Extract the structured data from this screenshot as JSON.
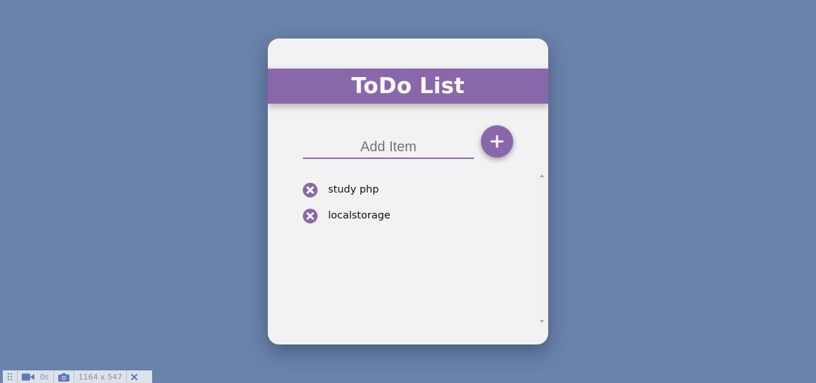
{
  "app": {
    "title": "ToDo List"
  },
  "input": {
    "placeholder": "Add Item",
    "value": ""
  },
  "add_button": {
    "icon": "plus-icon"
  },
  "items": [
    {
      "label": "study php",
      "icon": "remove-circle-icon"
    },
    {
      "label": "localstorage",
      "icon": "remove-circle-icon"
    }
  ],
  "toolbar": {
    "timer": "0s",
    "dimensions": "1164 x 547"
  },
  "colors": {
    "background": "#6a83ab",
    "accent": "#8a67ab",
    "card": "#f3f2f3"
  }
}
